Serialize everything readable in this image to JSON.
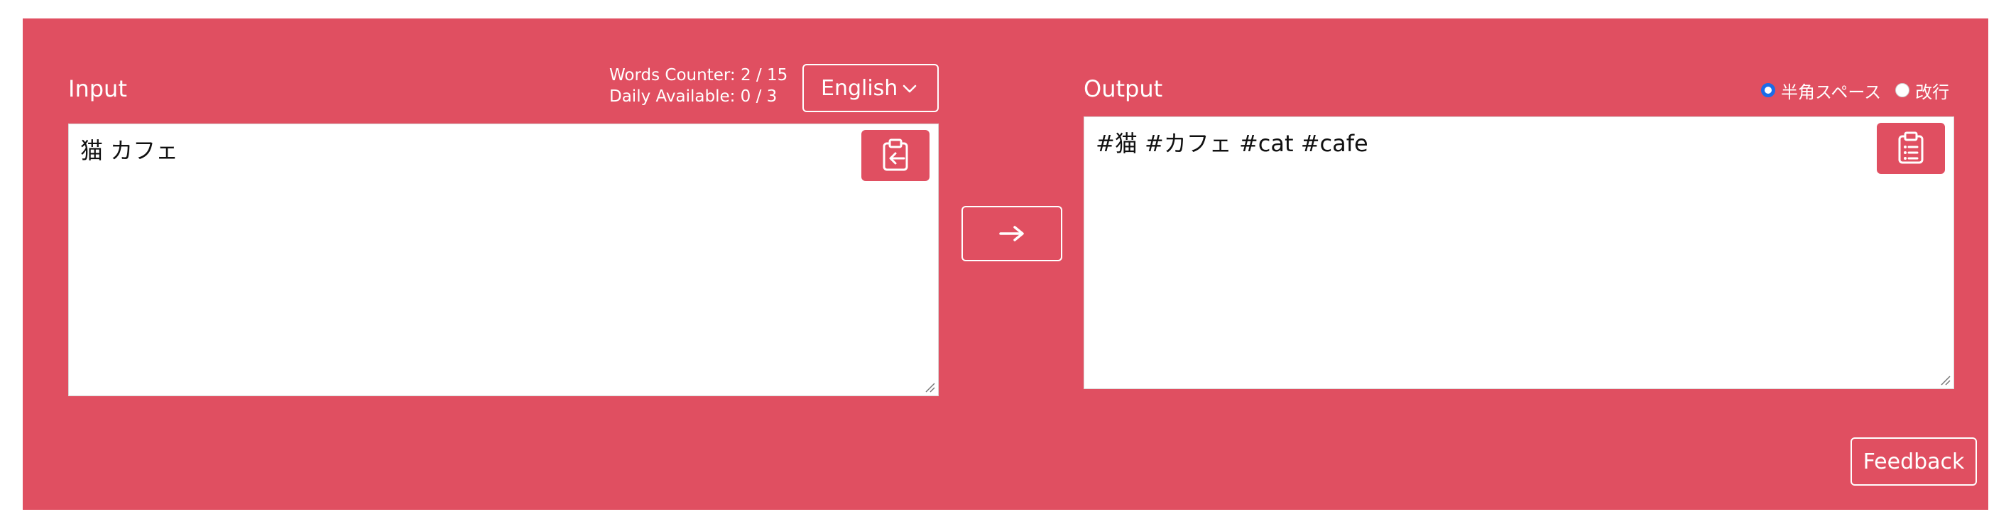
{
  "input": {
    "label": "Input",
    "words_counter": "Words Counter: 2 / 15",
    "daily_available": "Daily Available: 0 / 3",
    "language": "English",
    "text": "猫 カフェ",
    "paste_icon": "clipboard-paste-icon"
  },
  "convert": {
    "icon": "arrow-right-icon"
  },
  "output": {
    "label": "Output",
    "separator_options": [
      {
        "label": "半角スペース",
        "checked": true
      },
      {
        "label": "改行",
        "checked": false
      }
    ],
    "text": "#猫 #カフェ #cat #cafe",
    "copy_icon": "clipboard-list-icon"
  },
  "feedback": {
    "label": "Feedback"
  },
  "colors": {
    "background": "#e04f61",
    "radio_accent": "#1a6ce8"
  }
}
